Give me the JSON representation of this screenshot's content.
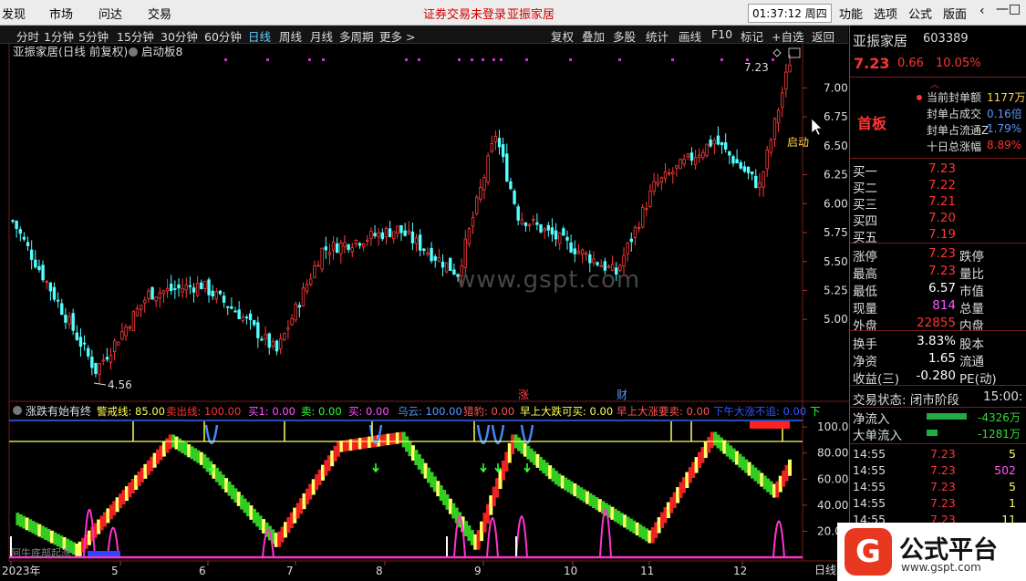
{
  "menu": {
    "left": [
      "发现",
      "市场",
      "问达",
      "交易"
    ],
    "notice": "证券交易未登录",
    "stock_name_top": "亚振家居",
    "clock": "01:37:12 周四",
    "right": [
      "功能",
      "选项",
      "公式",
      "版面"
    ],
    "window_buttons": [
      "‹",
      "—",
      "□",
      "×"
    ]
  },
  "toolbar": {
    "periods": [
      "分时",
      "1分钟",
      "5分钟",
      "15分钟",
      "30分钟",
      "60分钟",
      "日线",
      "周线",
      "月线",
      "多周期",
      "更多 >"
    ],
    "active": "日线",
    "tools": [
      "复权",
      "叠加",
      "多股",
      "统计",
      "画线",
      "F10",
      "标记",
      "+自选",
      "返回"
    ]
  },
  "chart": {
    "title": "亚振家居(日线 前复权)",
    "indicator_name": "启动板8",
    "high_label": "7.23",
    "low_label": "4.56",
    "right_tag": "启动",
    "price_ticks": [
      "7.00",
      "6.75",
      "6.50",
      "6.25",
      "6.00",
      "5.75",
      "5.50",
      "5.25",
      "5.00"
    ],
    "markers": [
      "涨",
      "财"
    ],
    "watermark": "www.gspt.com"
  },
  "indicator": {
    "name": "涨跌有始有终",
    "items": [
      {
        "label": "警戒线: 85.00",
        "color": "#ffff55"
      },
      {
        "label": "卖出线: 100.00",
        "color": "#ff3333"
      },
      {
        "label": "买1: 0.00",
        "color": "#ff55ff"
      },
      {
        "label": "卖: 0.00",
        "color": "#33ff33"
      },
      {
        "label": "买: 0.00",
        "color": "#ff55ff"
      },
      {
        "label": "乌云: 100.00",
        "color": "#5599ff"
      },
      {
        "label": "猎豹: 0.00",
        "color": "#ff5555"
      },
      {
        "label": "早上大跌可买: 0.00",
        "color": "#ffff55"
      },
      {
        "label": "早上大涨要卖: 0.00",
        "color": "#ff5555"
      },
      {
        "label": "下午大涨不追: 0.00",
        "color": "#3355ff"
      },
      {
        "label": "下",
        "color": "#33ff33"
      }
    ],
    "ticks": [
      "100.0",
      "80.00",
      "60.00",
      "40.00",
      "20.00"
    ],
    "bottom_label": "阿牛底部起涨"
  },
  "x_axis": {
    "labels": [
      "2023年",
      "5",
      "6",
      "7",
      "8",
      "9",
      "10",
      "11",
      "12"
    ],
    "right_label": "日线"
  },
  "quote": {
    "name": "亚振家居",
    "code": "603389",
    "price": "7.23",
    "change": "0.66",
    "pct": "10.05%",
    "board": "首板",
    "board_info": [
      {
        "k": "当前封单额",
        "v": "1177万"
      },
      {
        "k": "封单占成交",
        "v": "0.16倍"
      },
      {
        "k": "封单占流通Z",
        "v": "1.79%"
      },
      {
        "k": "十日总涨幅",
        "v": "8.89%"
      }
    ],
    "asks": [
      {
        "k": "买一",
        "v": "7.23"
      },
      {
        "k": "买二",
        "v": "7.22"
      },
      {
        "k": "买三",
        "v": "7.21"
      },
      {
        "k": "买四",
        "v": "7.20"
      },
      {
        "k": "买五",
        "v": "7.19"
      }
    ],
    "stats": [
      {
        "k": "涨停",
        "v": "7.23",
        "k2": "跌停",
        "c": "#ff3333"
      },
      {
        "k": "最高",
        "v": "7.23",
        "k2": "量比",
        "c": "#ff3333"
      },
      {
        "k": "最低",
        "v": "6.57",
        "k2": "市值",
        "c": "#ffffff"
      },
      {
        "k": "现量",
        "v": "814",
        "k2": "总量",
        "c": "#ff55ff"
      },
      {
        "k": "外盘",
        "v": "22855",
        "k2": "内盘",
        "c": "#ff3333"
      }
    ],
    "stats2": [
      {
        "k": "换手",
        "v": "3.83%",
        "k2": "股本",
        "c": "#ffffff"
      },
      {
        "k": "净资",
        "v": "1.65",
        "k2": "流通",
        "c": "#ffffff"
      },
      {
        "k": "收益(三)",
        "v": "-0.280",
        "k2": "PE(动)",
        "c": "#ffffff"
      }
    ],
    "trade_status": "交易状态: 闭市阶段",
    "trade_time": "15:00:",
    "flows": [
      {
        "k": "净流入",
        "v": "-4326万"
      },
      {
        "k": "大单流入",
        "v": "-1281万"
      }
    ],
    "ticks": [
      {
        "t": "14:55",
        "p": "7.23",
        "q": "5",
        "qc": "#ffff55"
      },
      {
        "t": "14:55",
        "p": "7.23",
        "q": "502",
        "qc": "#ff55ff"
      },
      {
        "t": "14:55",
        "p": "7.23",
        "q": "5",
        "qc": "#ffff55"
      },
      {
        "t": "14:55",
        "p": "7.23",
        "q": "1",
        "qc": "#ffff55"
      },
      {
        "t": "14:55",
        "p": "7.23",
        "q": "11",
        "qc": "#ffff55"
      }
    ]
  },
  "logo": {
    "badge": "G",
    "text": "公式平台",
    "url": "www.gspt.com"
  },
  "chart_data": {
    "type": "candlestick",
    "y_ticks": [
      5.0,
      5.25,
      5.5,
      5.75,
      6.0,
      6.25,
      6.5,
      6.75,
      7.0
    ],
    "ylim": [
      4.45,
      7.35
    ],
    "segments": [
      {
        "from": 5.85,
        "to": 4.56,
        "n": 22
      },
      {
        "from": 4.56,
        "to": 5.22,
        "n": 14
      },
      {
        "from": 5.22,
        "to": 5.3,
        "n": 14
      },
      {
        "from": 5.3,
        "to": 5.05,
        "n": 10
      },
      {
        "from": 5.05,
        "to": 4.72,
        "n": 10
      },
      {
        "from": 4.72,
        "to": 5.6,
        "n": 12
      },
      {
        "from": 5.6,
        "to": 5.78,
        "n": 20
      },
      {
        "from": 5.78,
        "to": 5.4,
        "n": 16
      },
      {
        "from": 5.4,
        "to": 6.6,
        "n": 10
      },
      {
        "from": 6.6,
        "to": 5.9,
        "n": 6
      },
      {
        "from": 5.9,
        "to": 5.4,
        "n": 26
      },
      {
        "from": 5.4,
        "to": 6.15,
        "n": 10
      },
      {
        "from": 6.15,
        "to": 6.55,
        "n": 16
      },
      {
        "from": 6.55,
        "to": 6.15,
        "n": 12
      },
      {
        "from": 6.15,
        "to": 7.23,
        "n": 8
      }
    ],
    "indicator_segments": [
      {
        "from": 30,
        "to": 5,
        "n": 20
      },
      {
        "from": 5,
        "to": 90,
        "n": 30
      },
      {
        "from": 90,
        "to": 75,
        "n": 10
      },
      {
        "from": 75,
        "to": 12,
        "n": 24
      },
      {
        "from": 12,
        "to": 85,
        "n": 20
      },
      {
        "from": 85,
        "to": 92,
        "n": 20
      },
      {
        "from": 92,
        "to": 10,
        "n": 24
      },
      {
        "from": 10,
        "to": 90,
        "n": 12
      },
      {
        "from": 90,
        "to": 60,
        "n": 14
      },
      {
        "from": 60,
        "to": 15,
        "n": 30
      },
      {
        "from": 15,
        "to": 92,
        "n": 20
      },
      {
        "from": 92,
        "to": 50,
        "n": 20
      },
      {
        "from": 50,
        "to": 75,
        "n": 6
      }
    ],
    "indicator_ylim": [
      0,
      105
    ]
  }
}
